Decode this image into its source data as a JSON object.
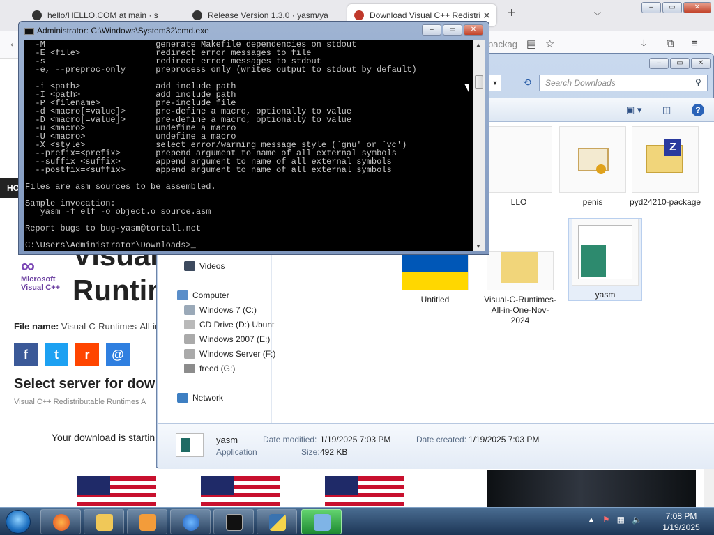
{
  "browser": {
    "tabs": [
      {
        "label": "hello/HELLO.COM at main · s"
      },
      {
        "label": "Release Version 1.3.0 · yasm/ya"
      },
      {
        "label": "Download Visual C++ Redistri"
      }
    ],
    "new_tab": "+",
    "url_fragment": "packag",
    "page": {
      "header_strip": "HO",
      "logo_text": "Microsoft Visual C++",
      "heading_line1": "Visual",
      "heading_line2": "Runtim",
      "file_name_label": "File name:",
      "file_name_value": "Visual-C-Runtimes-All-in",
      "share_buttons": [
        "f",
        "t",
        "r",
        "@"
      ],
      "select_server": "Select server for dow",
      "server_subtitle": "Visual C++ Redistributable Runtimes A",
      "download_status": "Your download is startin"
    }
  },
  "cmd": {
    "title": "Administrator: C:\\Windows\\System32\\cmd.exe",
    "lines": [
      "  -M                      generate Makefile dependencies on stdout",
      "  -E <file>               redirect error messages to file",
      "  -s                      redirect error messages to stdout",
      "  -e, --preproc-only      preprocess only (writes output to stdout by default)",
      "",
      "  -i <path>               add include path",
      "  -I <path>               add include path",
      "  -P <filename>           pre-include file",
      "  -d <macro[=value]>      pre-define a macro, optionally to value",
      "  -D <macro[=value]>      pre-define a macro, optionally to value",
      "  -u <macro>              undefine a macro",
      "  -U <macro>              undefine a macro",
      "  -X <style>              select error/warning message style (`gnu' or `vc')",
      "  --prefix=<prefix>       prepend argument to name of all external symbols",
      "  --suffix=<suffix>       append argument to name of all external symbols",
      "  --postfix=<suffix>      append argument to name of all external symbols",
      "",
      "Files are asm sources to be assembled.",
      "",
      "Sample invocation:",
      "   yasm -f elf -o object.o source.asm",
      "",
      "Report bugs to bug-yasm@tortall.net",
      "",
      "C:\\Users\\Administrator\\Downloads>_"
    ]
  },
  "explorer": {
    "search_placeholder": "Search Downloads",
    "nav": {
      "videos": "Videos",
      "computer": "Computer",
      "drives": [
        "Windows 7 (C:)",
        "CD Drive (D:) Ubunt",
        "Windows 2007 (E:)",
        "Windows Server (F:)",
        "freed (G:)"
      ],
      "network": "Network"
    },
    "files": [
      {
        "name": "LLO"
      },
      {
        "name": "penis"
      },
      {
        "name": "pyd24210-package"
      },
      {
        "name": "Untitled"
      },
      {
        "name": "Visual-C-Runtimes-All-in-One-Nov-2024"
      },
      {
        "name": "yasm"
      }
    ],
    "details": {
      "name": "yasm",
      "type": "Application",
      "modified_label": "Date modified:",
      "modified_value": "1/19/2025 7:03 PM",
      "created_label": "Date created:",
      "created_value": "1/19/2025 7:03 PM",
      "size_label": "Size:",
      "size_value": "492 KB"
    }
  },
  "taskbar": {
    "time": "7:08 PM",
    "date": "1/19/2025"
  }
}
